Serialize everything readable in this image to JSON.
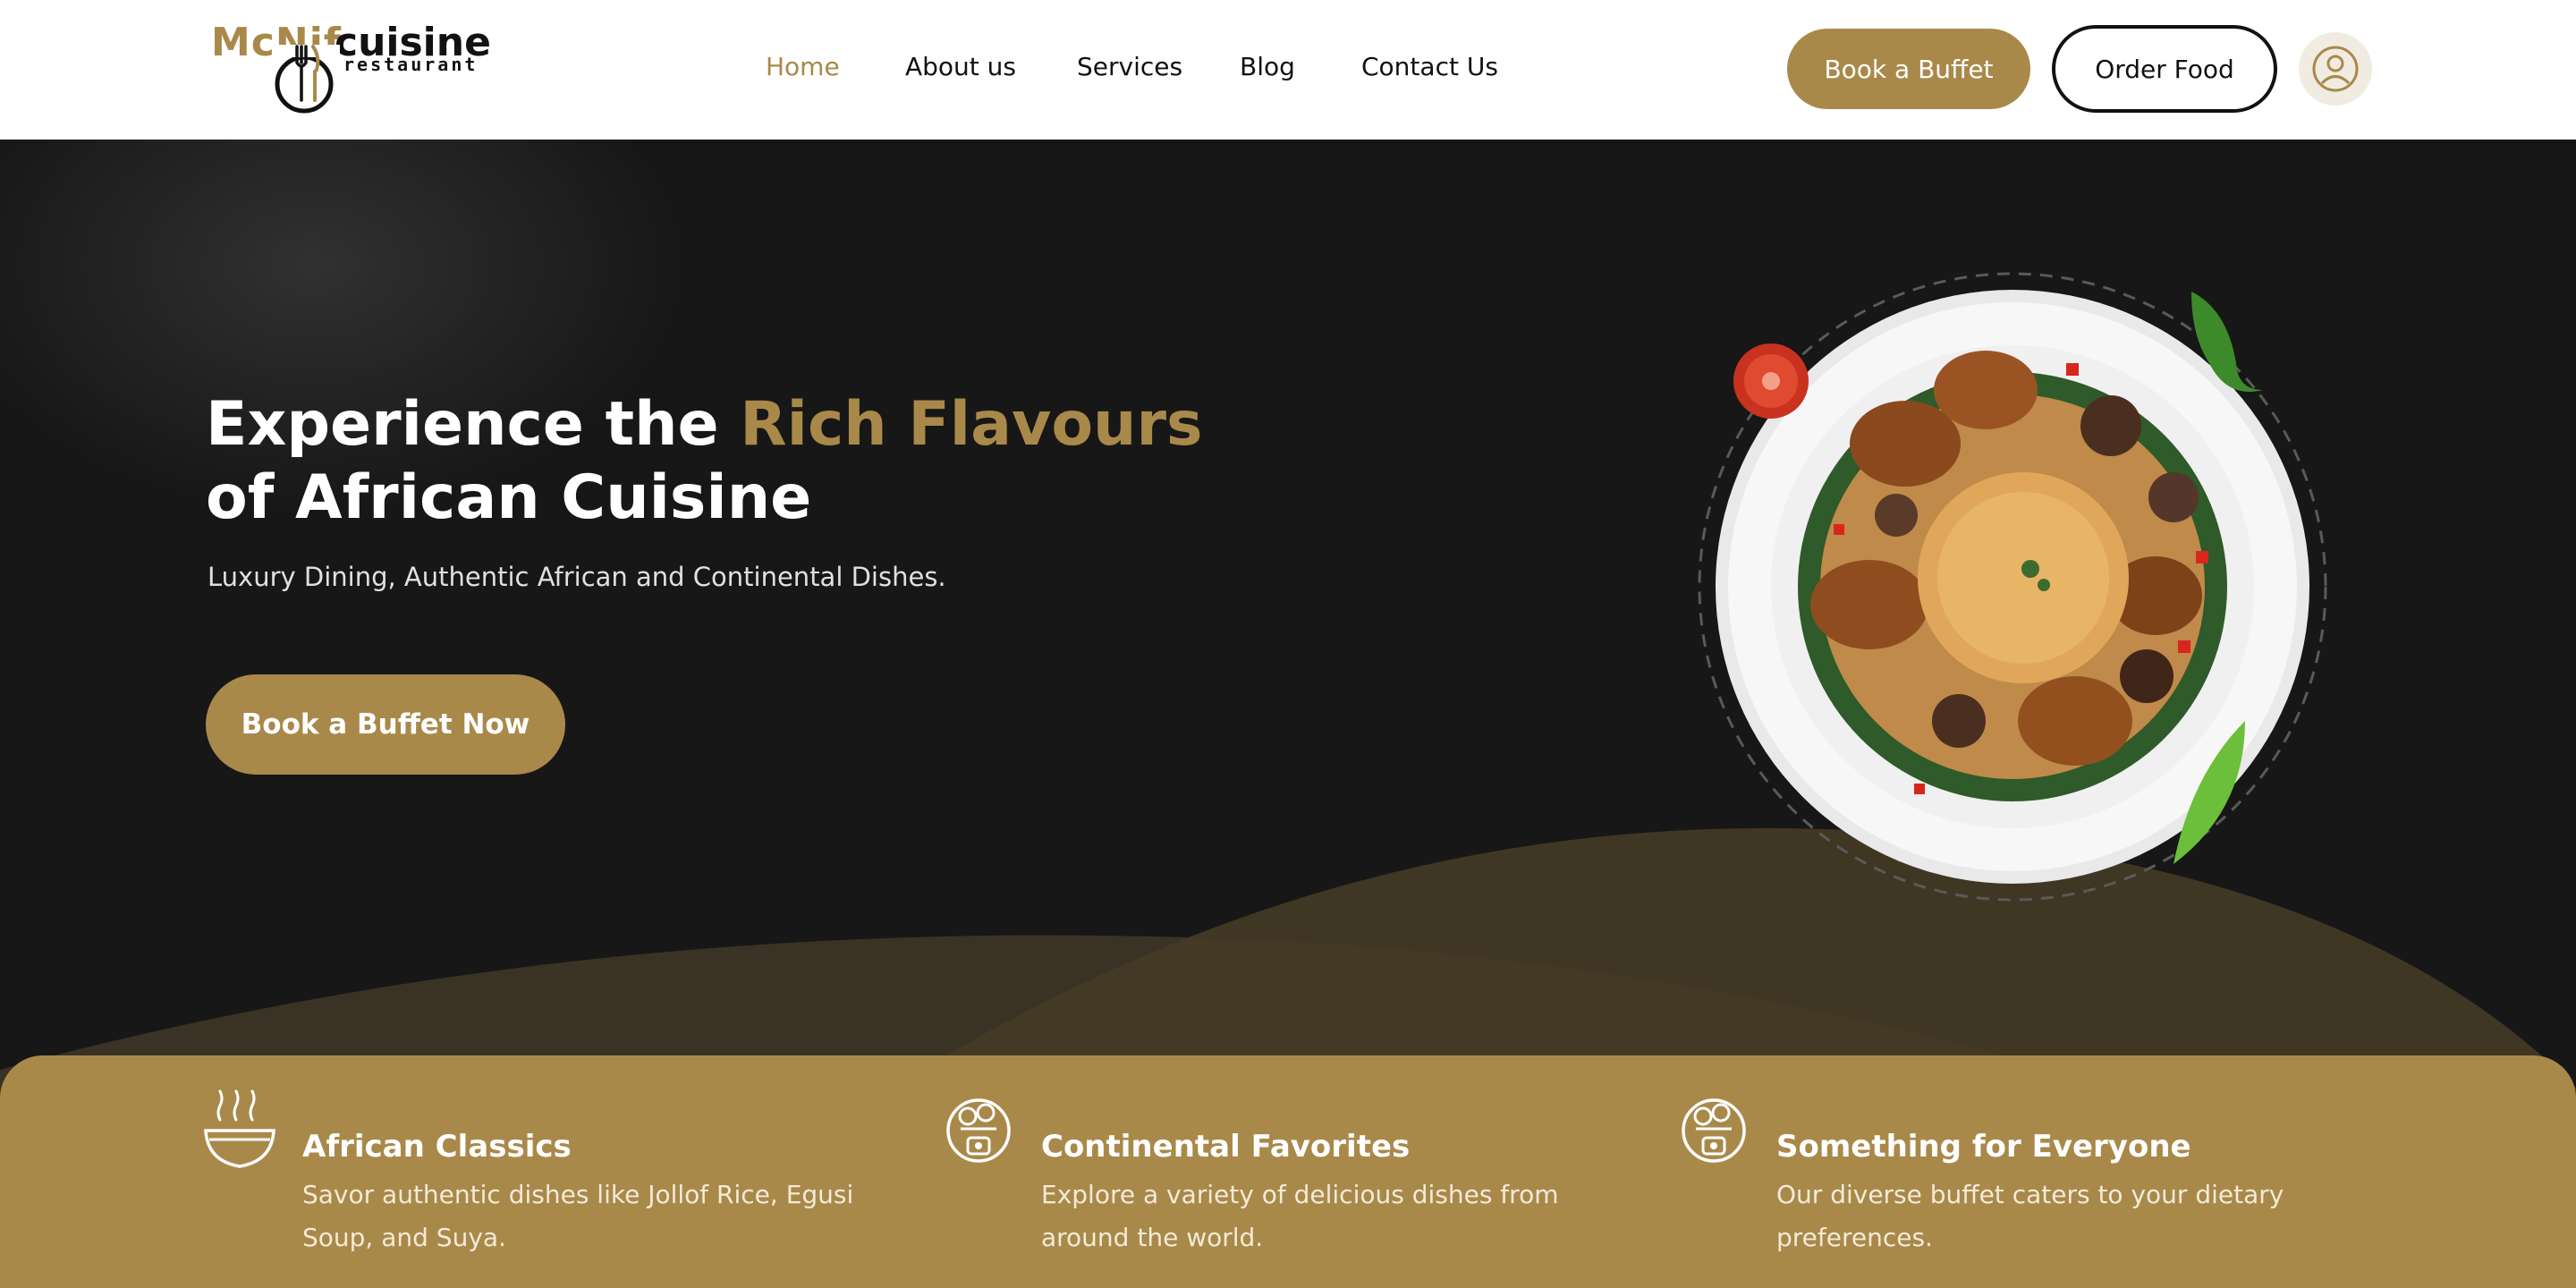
{
  "brand": {
    "logo_main": "McNif",
    "logo_secondary": "cuisine",
    "logo_tagline": "restaurant",
    "accent_color": "#a9894a",
    "dark_color": "#171717"
  },
  "nav": {
    "items": [
      {
        "label": "Home",
        "active": true
      },
      {
        "label": "About us",
        "active": false
      },
      {
        "label": "Services",
        "active": false
      },
      {
        "label": "Blog",
        "active": false
      },
      {
        "label": "Contact Us",
        "active": false
      }
    ]
  },
  "header_actions": {
    "book_buffet_label": "Book a Buffet",
    "order_food_label": "Order Food",
    "profile_icon": "user-circle-icon"
  },
  "hero": {
    "title_part1": "Experience the ",
    "title_accent": "Rich Flavours",
    "title_part2": " of African Cuisine",
    "subtitle": "Luxury Dining, Authentic African and Continental Dishes.",
    "cta_label": "Book a Buffet Now",
    "image_name": "jollof-rice-plate"
  },
  "features": [
    {
      "icon": "soup-bowl-icon",
      "title": "African Classics",
      "description": "Savor authentic dishes like Jollof Rice, Egusi Soup, and Suya."
    },
    {
      "icon": "food-platter-icon",
      "title": "Continental Favorites",
      "description": "Explore a variety of delicious dishes from around the world."
    },
    {
      "icon": "food-platter-icon",
      "title": "Something for Everyone",
      "description": "Our diverse buffet caters to your dietary preferences."
    }
  ]
}
